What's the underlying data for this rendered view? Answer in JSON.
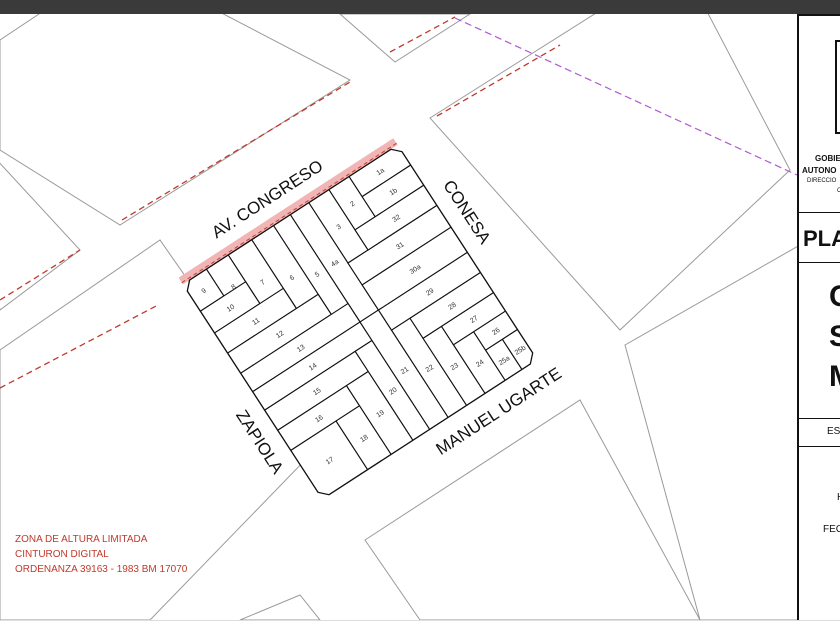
{
  "streets": {
    "north": "AV. CONGRESO",
    "east": "CONESA",
    "west": "ZAPIOLA",
    "south": "MANUEL UGARTE"
  },
  "parcels": [
    "1a",
    "1b",
    "2",
    "3",
    "4a",
    "5",
    "6",
    "7",
    "8",
    "9",
    "10",
    "11",
    "12",
    "13",
    "14",
    "15",
    "16",
    "17",
    "18",
    "19",
    "20",
    "21",
    "22",
    "23",
    "24",
    "25a",
    "25b",
    "26",
    "27",
    "28",
    "29",
    "30a",
    "31",
    "32"
  ],
  "legend": {
    "line1": "ZONA DE ALTURA LIMITADA",
    "line2": "CINTURON DIGITAL",
    "line3": "ORDENANZA 39163 - 1983 BM 17070"
  },
  "title_block": {
    "org1": "GOBIE",
    "org2": "AUTONO",
    "org3": "DIRECCIO",
    "org4": "C",
    "plan": "PLA",
    "big1": "C",
    "big2": "S",
    "big3": "M",
    "scale": "ES",
    "h": "H",
    "date": "FEC"
  },
  "colors": {
    "red": "#c0392b",
    "purple": "#b05ad0",
    "line": "#111111",
    "grid": "#9a9a9a"
  }
}
